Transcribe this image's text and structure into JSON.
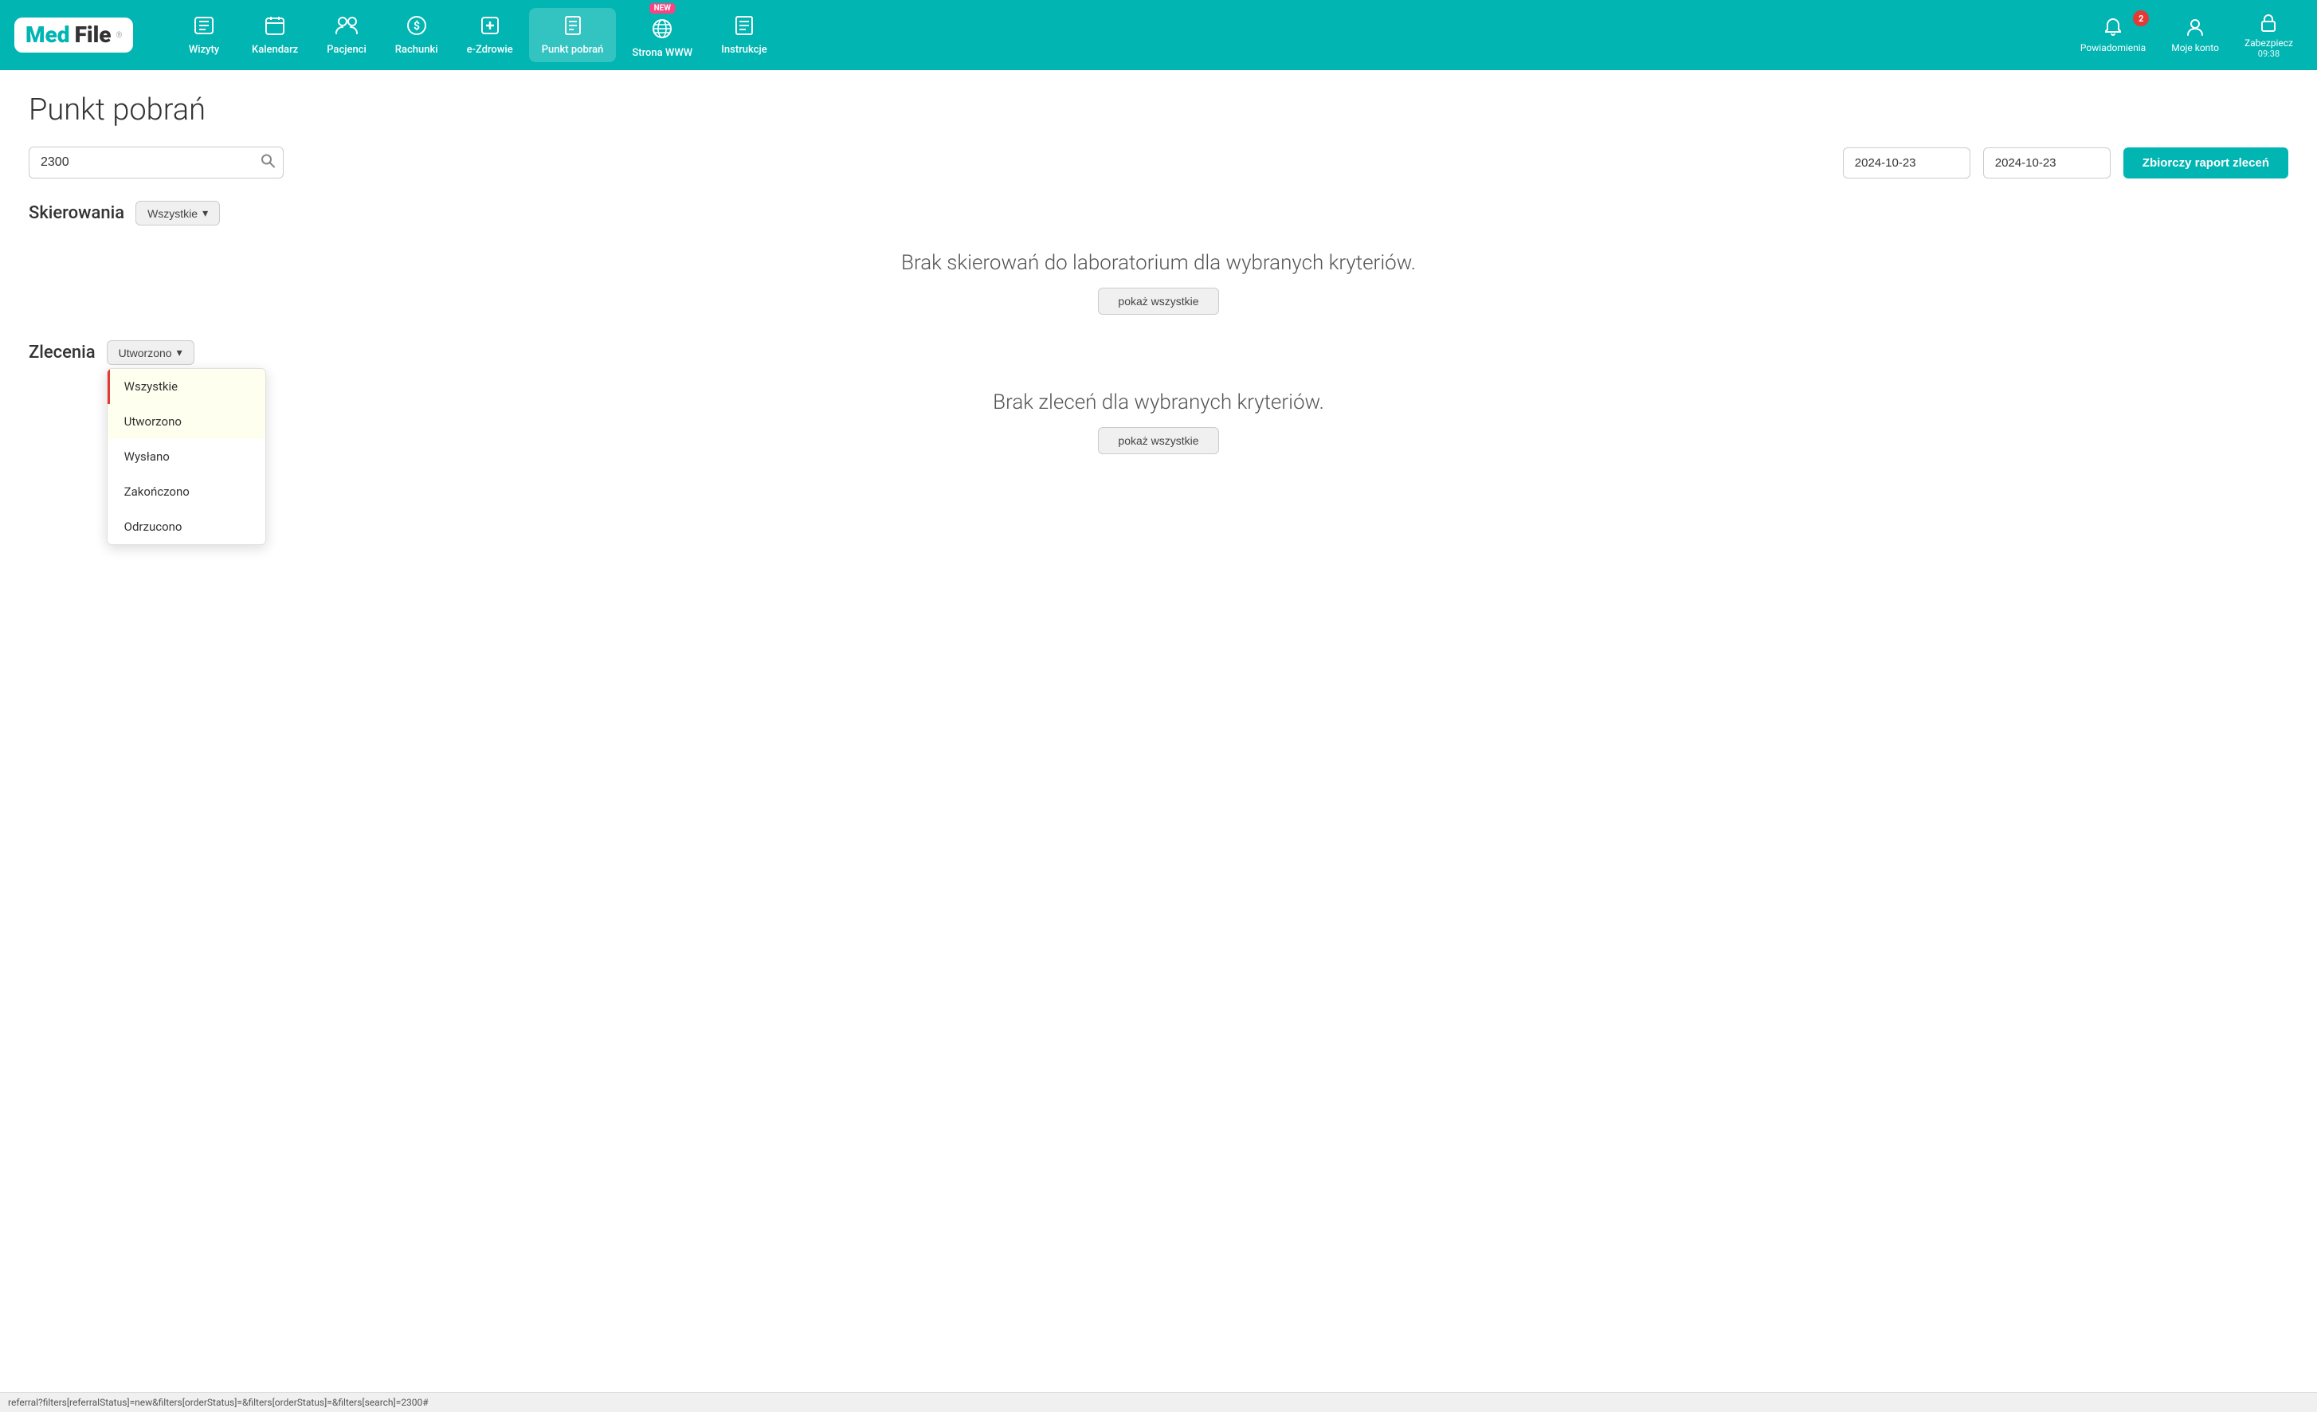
{
  "logo": {
    "med": "Med",
    "file": "File",
    "reg": "®"
  },
  "nav": {
    "items": [
      {
        "id": "wizyty",
        "icon": "📋",
        "label": "Wizyty"
      },
      {
        "id": "kalendarz",
        "icon": "📅",
        "label": "Kalendarz"
      },
      {
        "id": "pacjenci",
        "icon": "👥",
        "label": "Pacjenci"
      },
      {
        "id": "rachunki",
        "icon": "💲",
        "label": "Rachunki"
      },
      {
        "id": "e-zdrowie",
        "icon": "➕",
        "label": "e-Zdrowie"
      },
      {
        "id": "punkt-pobran",
        "icon": "📄",
        "label": "Punkt pobrań",
        "active": true
      },
      {
        "id": "strona-www",
        "icon": "🌐",
        "label": "Strona WWW",
        "new": true
      },
      {
        "id": "instrukcje",
        "icon": "📋",
        "label": "Instrukcje"
      }
    ],
    "right": [
      {
        "id": "powiadomienia",
        "icon": "🔔",
        "label": "Powiadomienia",
        "badge": "2"
      },
      {
        "id": "moje-konto",
        "icon": "👤",
        "label": "Moje konto"
      },
      {
        "id": "zabezpiecz",
        "icon": "🔒",
        "label": "Zabezpiecz",
        "time": "09:38"
      }
    ]
  },
  "page": {
    "title": "Punkt pobrań"
  },
  "search": {
    "value": "2300",
    "placeholder": ""
  },
  "dates": {
    "from": "2024-10-23",
    "to": "2024-10-23"
  },
  "report_button": "Zbiorczy raport zleceń",
  "skierowania": {
    "label": "Skierowania",
    "filter_label": "Wszystkie",
    "empty_message": "Brak skierowań do laboratorium dla wybranych kryteriów.",
    "show_all_label": "pokaż wszystkie"
  },
  "zlecenia": {
    "label": "Zlecenia",
    "filter_label": "Utworzono",
    "empty_message": "Brak zleceń dla wybranych kryteriów.",
    "show_all_label": "pokaż wszystkie",
    "dropdown": {
      "options": [
        {
          "id": "wszystkie",
          "label": "Wszystkie",
          "active": true
        },
        {
          "id": "utworzono",
          "label": "Utworzono",
          "selected": true
        },
        {
          "id": "wyslano",
          "label": "Wysłano"
        },
        {
          "id": "zakonczone",
          "label": "Zakończono"
        },
        {
          "id": "odrzucono",
          "label": "Odrzucono"
        }
      ]
    }
  },
  "status_bar": {
    "url": "referral?filters[referralStatus]=new&filters[orderStatus]=&filters[orderStatus]=&filters[search]=2300#"
  }
}
